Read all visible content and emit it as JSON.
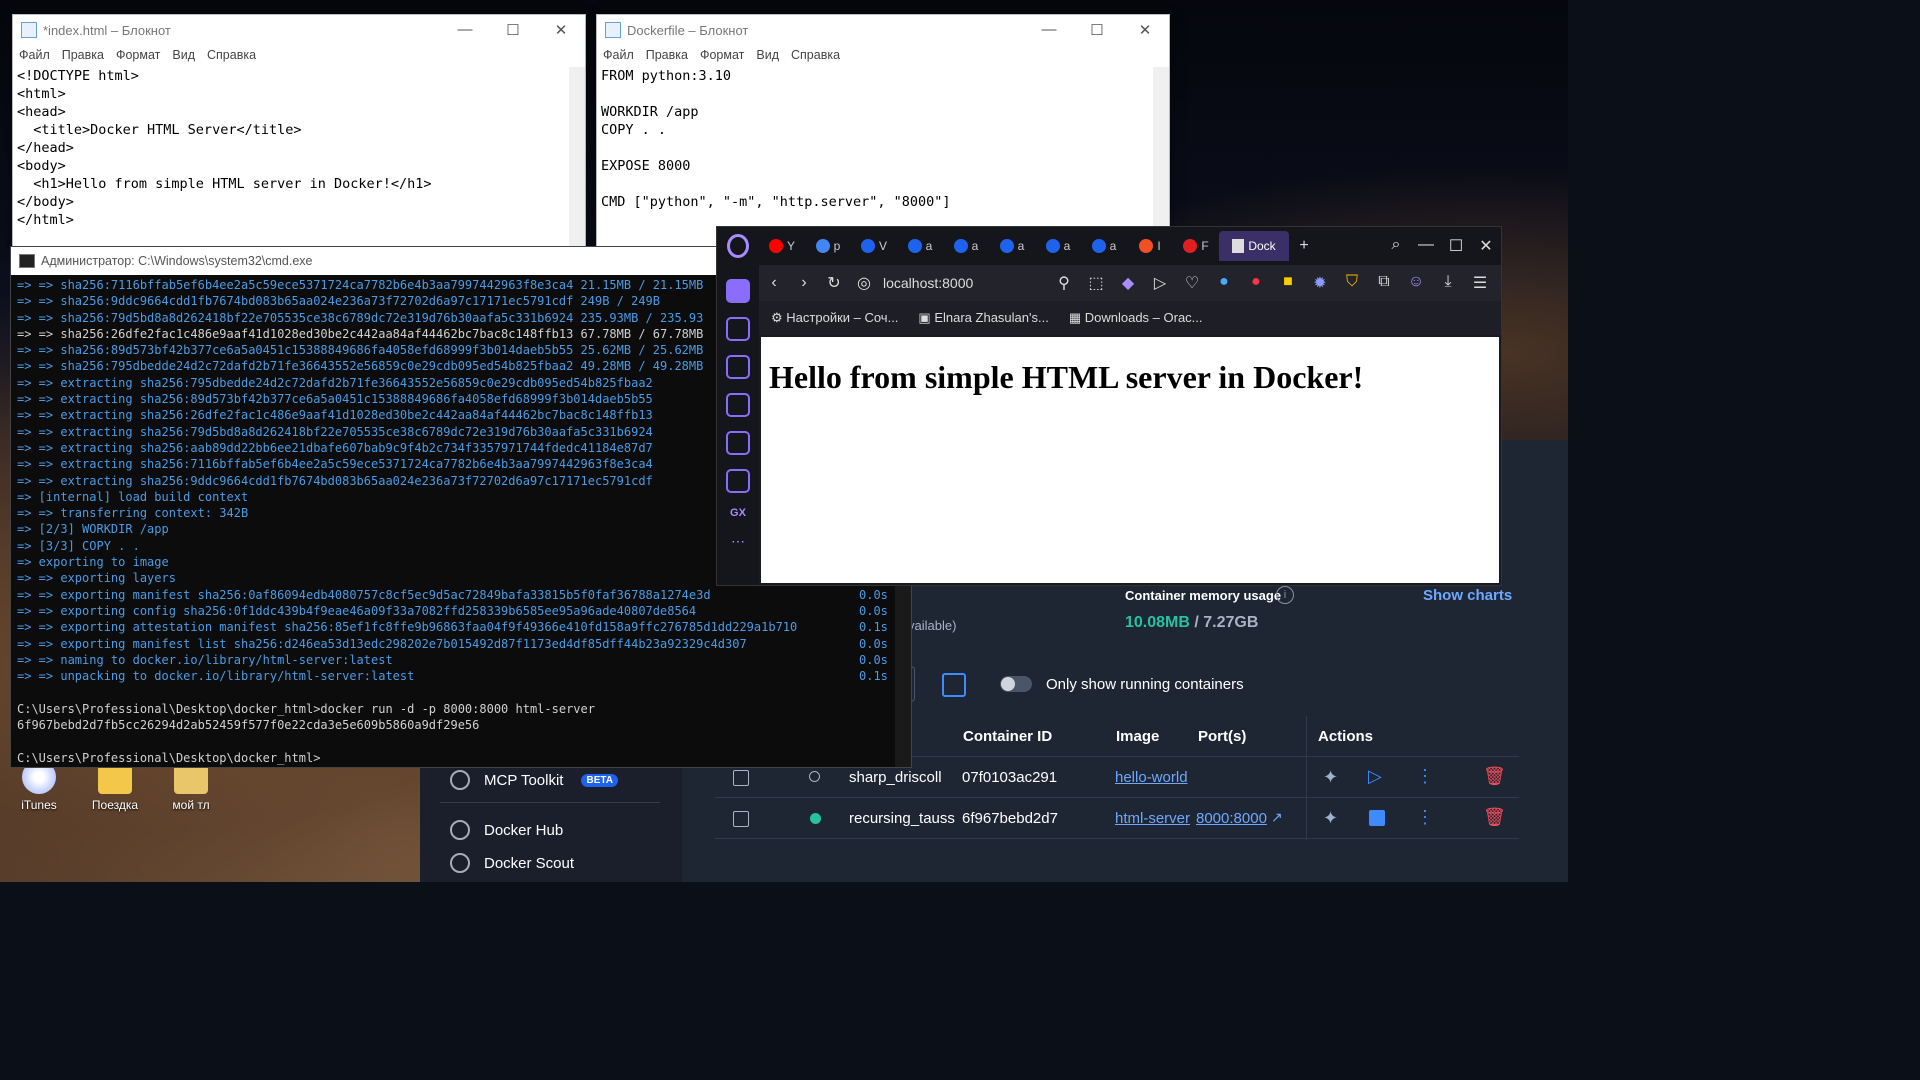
{
  "desktop": {
    "icons": [
      {
        "label": "iTunes"
      },
      {
        "label": "Поездка"
      },
      {
        "label": "мой тл"
      }
    ]
  },
  "notepad_index": {
    "title": "*index.html – Блокнот",
    "menu": [
      "Файл",
      "Правка",
      "Формат",
      "Вид",
      "Справка"
    ],
    "lines": [
      "<!DOCTYPE html>",
      "<html>",
      "<head>",
      "  <title>Docker HTML Server</title>",
      "</head>",
      "<body>",
      "  <h1>Hello from simple HTML server in Docker!</h1>",
      "</body>",
      "</html>"
    ]
  },
  "notepad_dockerfile": {
    "title": "Dockerfile – Блокнот",
    "menu": [
      "Файл",
      "Правка",
      "Формат",
      "Вид",
      "Справка"
    ],
    "lines": [
      "FROM python:3.10",
      "",
      "WORKDIR /app",
      "COPY . .",
      "",
      "EXPOSE 8000",
      "",
      "CMD [\"python\", \"-m\", \"http.server\", \"8000\"]"
    ]
  },
  "cmd": {
    "title": "Администратор: C:\\Windows\\system32\\cmd.exe",
    "lines": [
      {
        "t": "=> => sha256:7116bffab5ef6b4ee2a5c59ece5371724ca7782b6e4b3aa7997442963f8e3ca4 21.15MB / 21.15MB",
        "r": "",
        "c": "b"
      },
      {
        "t": "=> => sha256:9ddc9664cdd1fb7674bd083b65aa024e236a73f72702d6a97c17171ec5791cdf 249B / 249B",
        "r": "",
        "c": "b"
      },
      {
        "t": "=> => sha256:79d5bd8a8d262418bf22e705535ce38c6789dc72e319d76b30aafa5c331b6924 235.93MB / 235.93",
        "r": "",
        "c": "b"
      },
      {
        "t": "=> => sha256:26dfe2fac1c486e9aaf41d1028ed30be2c442aa84af44462bc7bac8c148ffb13 67.78MB / 67.78MB",
        "r": "",
        "c": "w"
      },
      {
        "t": "=> => sha256:89d573bf42b377ce6a5a0451c15388849686fa4058efd68999f3b014daeb5b55 25.62MB / 25.62MB",
        "r": "",
        "c": "b"
      },
      {
        "t": "=> => sha256:795dbedde24d2c72dafd2b71fe36643552e56859c0e29cdb095ed54b825fbaa2 49.28MB / 49.28MB",
        "r": "",
        "c": "b"
      },
      {
        "t": "=> => extracting sha256:795dbedde24d2c72dafd2b71fe36643552e56859c0e29cdb095ed54b825fbaa2",
        "r": "",
        "c": "b"
      },
      {
        "t": "=> => extracting sha256:89d573bf42b377ce6a5a0451c15388849686fa4058efd68999f3b014daeb5b55",
        "r": "",
        "c": "b"
      },
      {
        "t": "=> => extracting sha256:26dfe2fac1c486e9aaf41d1028ed30be2c442aa84af44462bc7bac8c148ffb13",
        "r": "",
        "c": "b"
      },
      {
        "t": "=> => extracting sha256:79d5bd8a8d262418bf22e705535ce38c6789dc72e319d76b30aafa5c331b6924",
        "r": "",
        "c": "b"
      },
      {
        "t": "=> => extracting sha256:aab89dd22bb6ee21dbafe607bab9c9f4b2c734f3357971744fdedc41184e87d7",
        "r": "",
        "c": "b"
      },
      {
        "t": "=> => extracting sha256:7116bffab5ef6b4ee2a5c59ece5371724ca7782b6e4b3aa7997442963f8e3ca4",
        "r": "",
        "c": "b"
      },
      {
        "t": "=> => extracting sha256:9ddc9664cdd1fb7674bd083b65aa024e236a73f72702d6a97c17171ec5791cdf",
        "r": "",
        "c": "b"
      },
      {
        "t": "=> [internal] load build context",
        "r": "",
        "c": "b"
      },
      {
        "t": "=> => transferring context: 342B",
        "r": "",
        "c": "b"
      },
      {
        "t": "=> [2/3] WORKDIR /app",
        "r": "",
        "c": "b"
      },
      {
        "t": "=> [3/3] COPY . .",
        "r": "",
        "c": "b"
      },
      {
        "t": "=> exporting to image",
        "r": "",
        "c": "b"
      },
      {
        "t": "=> => exporting layers",
        "r": "",
        "c": "b"
      },
      {
        "t": "=> => exporting manifest sha256:0af86094edb4080757c8cf5ec9d5ac72849bafa33815b5f0faf36788a1274e3d",
        "r": "0.0s",
        "c": "b"
      },
      {
        "t": "=> => exporting config sha256:0f1ddc439b4f9eae46a09f33a7082ffd258339b6585ee95a96ade40807de8564",
        "r": "0.0s",
        "c": "b"
      },
      {
        "t": "=> => exporting attestation manifest sha256:85ef1fc8ffe9b96863faa04f9f49366e410fd158a9ffc276785d1dd229a1b710",
        "r": "0.1s",
        "c": "b"
      },
      {
        "t": "=> => exporting manifest list sha256:d246ea53d13edc298202e7b015492d87f1173ed4df85dff44b23a92329c4d307",
        "r": "0.0s",
        "c": "b"
      },
      {
        "t": "=> => naming to docker.io/library/html-server:latest",
        "r": "0.0s",
        "c": "b"
      },
      {
        "t": "=> => unpacking to docker.io/library/html-server:latest",
        "r": "0.1s",
        "c": "b"
      },
      {
        "t": "",
        "r": "",
        "c": "w"
      },
      {
        "t": "C:\\Users\\Professional\\Desktop\\docker_html>docker run -d -p 8000:8000 html-server",
        "r": "",
        "c": "w"
      },
      {
        "t": "6f967bebd2d7fb5cc26294d2ab52459f577f0e22cda3e5e609b5860a9df29e56",
        "r": "",
        "c": "w"
      },
      {
        "t": "",
        "r": "",
        "c": "w"
      },
      {
        "t": "C:\\Users\\Professional\\Desktop\\docker_html>",
        "r": "",
        "c": "w"
      }
    ]
  },
  "browser": {
    "tabs": [
      {
        "label": "Y",
        "color": "#ff0000"
      },
      {
        "label": "p",
        "color": "#4285f4"
      },
      {
        "label": "V",
        "color": "#1d63ed"
      },
      {
        "label": "a",
        "color": "#1d63ed"
      },
      {
        "label": "a",
        "color": "#1d63ed"
      },
      {
        "label": "a",
        "color": "#1d63ed"
      },
      {
        "label": "a",
        "color": "#1d63ed"
      },
      {
        "label": "a",
        "color": "#1d63ed"
      },
      {
        "label": "I",
        "color": "#f25022"
      },
      {
        "label": "F",
        "color": "#e02020"
      }
    ],
    "active_tab": "Dock",
    "url": "localhost:8000",
    "bookmarks": [
      "Настройки – Соч...",
      "Elnara Zhasulan's...",
      "Downloads – Orac..."
    ],
    "page_heading": "Hello from simple HTML server in Docker!",
    "sidebar_label": "GX"
  },
  "docker": {
    "sidebar": [
      {
        "label": "MCP Toolkit",
        "badge": "BETA"
      },
      {
        "label": "Docker Hub"
      },
      {
        "label": "Docker Scout"
      }
    ],
    "memory": {
      "label": "Container memory usage",
      "used": "10.08MB",
      "total": "/ 7.27GB",
      "cpu_fragment": "vailable)"
    },
    "show_charts": "Show charts",
    "only_running": "Only show running containers",
    "columns": [
      "Container ID",
      "Image",
      "Port(s)",
      "Actions"
    ],
    "rows": [
      {
        "name": "sharp_driscoll",
        "id": "07f0103ac291",
        "image": "hello-world",
        "ports": "",
        "running": false
      },
      {
        "name": "recursing_tauss",
        "id": "6f967bebd2d7",
        "image": "html-server",
        "ports": "8000:8000",
        "running": true
      }
    ]
  }
}
